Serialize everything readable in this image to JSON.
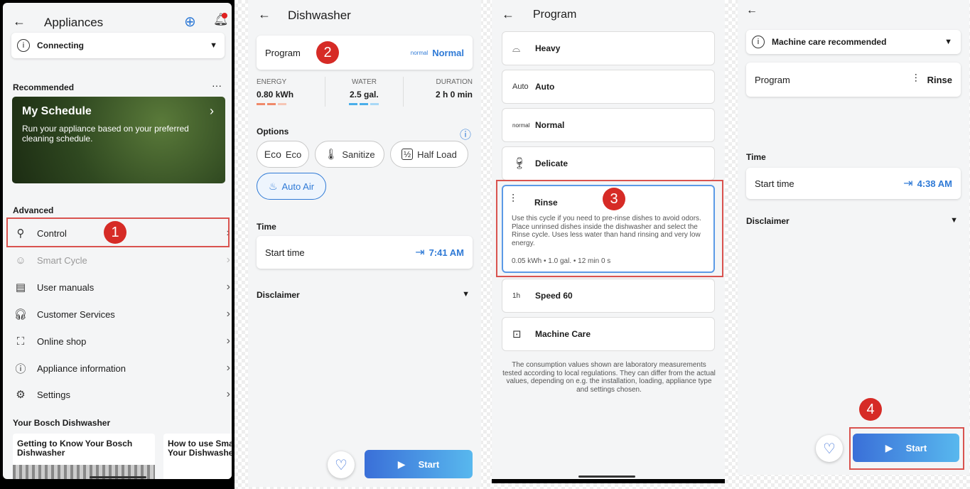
{
  "panel1": {
    "title": "Appliances",
    "connecting": "Connecting",
    "recommended_label": "Recommended",
    "more": "···",
    "schedule_title": "My Schedule",
    "schedule_desc": "Run your appliance based on your preferred cleaning schedule.",
    "advanced_label": "Advanced",
    "menu": [
      {
        "label": "Control",
        "icon": "control-icon"
      },
      {
        "label": "Smart Cycle",
        "icon": "smart-cycle-icon"
      },
      {
        "label": "User manuals",
        "icon": "manual-icon"
      },
      {
        "label": "Customer Services",
        "icon": "headset-icon"
      },
      {
        "label": "Online shop",
        "icon": "bag-icon"
      },
      {
        "label": "Appliance information",
        "icon": "info-icon"
      },
      {
        "label": "Settings",
        "icon": "gear-icon"
      }
    ],
    "your_label": "Your Bosch Dishwasher",
    "article1": "Getting to Know Your Bosch Dishwasher",
    "article2": "How to use Sma Your Dishwashe",
    "badge": "1"
  },
  "panel2": {
    "title": "Dishwasher",
    "program_label": "Program",
    "program_tag": "normal",
    "program_value": "Normal",
    "badge": "2",
    "energy_label": "ENERGY",
    "energy_value": "0.80 kWh",
    "water_label": "WATER",
    "water_value": "2.5 gal.",
    "duration_label": "DURATION",
    "duration_value": "2 h 0 min",
    "options_label": "Options",
    "options": [
      "Eco",
      "Sanitize",
      "Half Load",
      "Auto Air"
    ],
    "eco_glyph": "Eco",
    "time_label": "Time",
    "start_time_label": "Start time",
    "start_time_value": "7:41 AM",
    "disclaimer": "Disclaimer",
    "start": "Start"
  },
  "panel3": {
    "title": "Program",
    "programs": [
      "Heavy",
      "Auto",
      "Normal",
      "Delicate"
    ],
    "auto_tag": "Auto",
    "normal_tag": "normal",
    "rinse_title": "Rinse",
    "rinse_desc": "Use this cycle if you need to pre-rinse dishes to avoid odors. Place unrinsed dishes inside the dishwasher and select the Rinse cycle. Uses less water than hand rinsing and very low energy.",
    "rinse_stats": "0.05 kWh • 1.0 gal. • 12 min 0 s",
    "badge": "3",
    "speed": "Speed 60",
    "speed_tag": "1h",
    "machine_care": "Machine Care",
    "footnote": "The consumption values shown are laboratory measurements tested according to local regulations. They can differ from the actual values, depending on e.g. the installation, loading, appliance type and settings chosen."
  },
  "panel4": {
    "machine_care_rec": "Machine care recommended",
    "program_label": "Program",
    "program_value": "Rinse",
    "time_label": "Time",
    "start_time_label": "Start time",
    "start_time_value": "4:38 AM",
    "disclaimer": "Disclaimer",
    "badge": "4",
    "start": "Start"
  },
  "colors": {
    "accent": "#2f7ad6",
    "badge": "#d62b26",
    "highlight": "#d9534f"
  }
}
